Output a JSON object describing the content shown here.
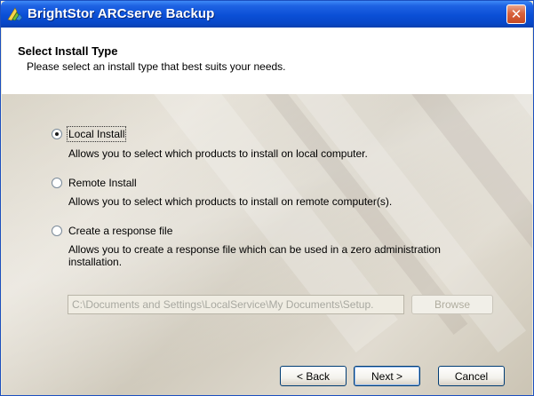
{
  "window": {
    "title": "BrightStor ARCserve Backup",
    "close_glyph": "✕"
  },
  "header": {
    "title": "Select Install Type",
    "subtitle": "Please select an install type that best suits your needs."
  },
  "options": [
    {
      "label": "Local Install",
      "description": "Allows you to select which products to install on local computer.",
      "selected": true
    },
    {
      "label": "Remote Install",
      "description": "Allows you to select which products to install on remote computer(s).",
      "selected": false
    },
    {
      "label": "Create a response file",
      "description_line1": "Allows you to create a response file which can be used in a zero administration",
      "description_line2": "installation.",
      "selected": false
    }
  ],
  "response_file": {
    "path_value": "C:\\Documents and Settings\\LocalService\\My Documents\\Setup.",
    "browse_label": "Browse"
  },
  "footer": {
    "back_label": "< Back",
    "next_label": "Next >",
    "cancel_label": "Cancel"
  },
  "icons": {
    "app": "brightstor-app-icon",
    "close": "close-icon"
  }
}
